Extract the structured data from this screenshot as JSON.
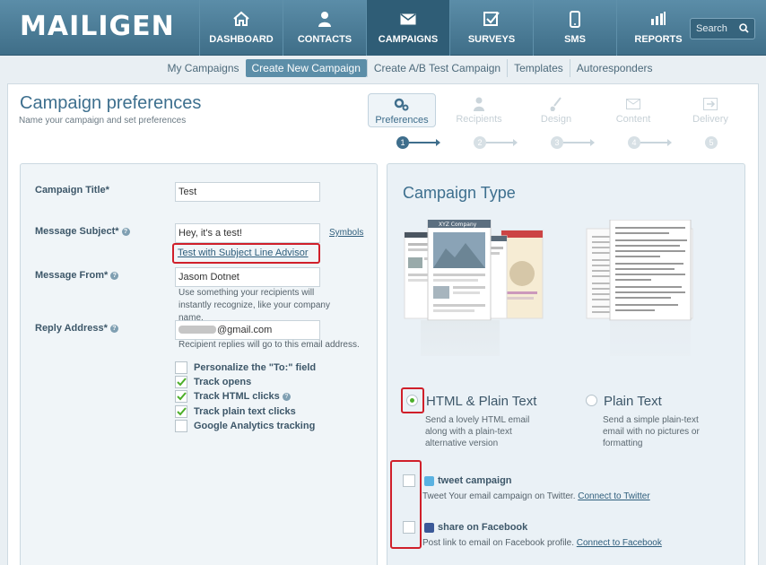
{
  "header": {
    "logo": "MAILIGEN",
    "search_label": "Search",
    "nav": [
      {
        "label": "DASHBOARD",
        "icon": "home-icon"
      },
      {
        "label": "CONTACTS",
        "icon": "user-icon"
      },
      {
        "label": "CAMPAIGNS",
        "icon": "envelope-icon"
      },
      {
        "label": "SURVEYS",
        "icon": "checkbox-icon"
      },
      {
        "label": "SMS",
        "icon": "phone-icon"
      },
      {
        "label": "REPORTS",
        "icon": "bar-chart-icon"
      }
    ]
  },
  "subnav": [
    "My Campaigns",
    "Create New Campaign",
    "Create A/B Test Campaign",
    "Templates",
    "Autoresponders"
  ],
  "page": {
    "title": "Campaign preferences",
    "subtitle": "Name your campaign and set preferences"
  },
  "steps": [
    {
      "label": "Preferences",
      "num": "1"
    },
    {
      "label": "Recipients",
      "num": "2"
    },
    {
      "label": "Design",
      "num": "3"
    },
    {
      "label": "Content",
      "num": "4"
    },
    {
      "label": "Delivery",
      "num": "5"
    }
  ],
  "form": {
    "title_label": "Campaign Title*",
    "title_value": "Test",
    "subject_label": "Message Subject*",
    "subject_value": "Hey, it's a test!",
    "symbols_link": "Symbols",
    "advisor_link": "Test with Subject Line Advisor",
    "from_label": "Message From*",
    "from_value": "Jasom Dotnet",
    "from_hint": "Use something your recipients will instantly recognize, like your company name.",
    "reply_label": "Reply Address*",
    "reply_value": "@gmail.com",
    "reply_hint": "Recipient replies will go to this email address.",
    "options": [
      {
        "label": "Personalize the \"To:\" field",
        "checked": false
      },
      {
        "label": "Track opens",
        "checked": true
      },
      {
        "label": "Track HTML clicks",
        "checked": true
      },
      {
        "label": "Track plain text clicks",
        "checked": true
      },
      {
        "label": "Google Analytics tracking",
        "checked": false
      }
    ]
  },
  "campaign_type": {
    "title": "Campaign Type",
    "html": {
      "label": "HTML & Plain Text",
      "desc": "Send a lovely HTML email along with a plain-text alternative version",
      "selected": true
    },
    "plain": {
      "label": "Plain Text",
      "desc": "Send a simple plain-text email with no pictures or formatting",
      "selected": false
    },
    "twitter": {
      "label": "tweet campaign",
      "desc": "Tweet Your email campaign on Twitter.",
      "link": "Connect to Twitter"
    },
    "facebook": {
      "label": "share on Facebook",
      "desc": "Post link to email on Facebook profile.",
      "link": "Connect to Facebook"
    },
    "thumb_company": "XYZ Company"
  },
  "colors": {
    "accent": "#3f6e8c",
    "highlight": "#d01f2a",
    "check": "#4caf2a"
  }
}
